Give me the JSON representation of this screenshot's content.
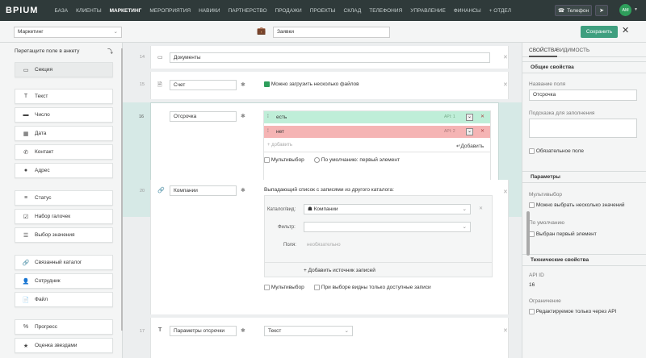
{
  "topbar": {
    "logo": "BPIUM",
    "nav": [
      "БАЗА",
      "КЛИЕНТЫ",
      "МАРКЕТИНГ",
      "МЕРОПРИЯТИЯ",
      "НАВИКИ",
      "ПАРТНЕРСТВО",
      "ПРОДАЖИ",
      "ПРОЕКТЫ",
      "СКЛАД",
      "ТЕЛЕФОНИЯ",
      "УПРАВЛЕНИЕ",
      "ФИНАНСЫ",
      "+ ОТДЕЛ"
    ],
    "active": "МАРКЕТИНГ",
    "phone": "Телефон",
    "avatar": "AM"
  },
  "toolbar": {
    "section": "Маркетинг",
    "form_name": "Заявки",
    "save": "Сохранить"
  },
  "left": {
    "header": "Перетащите поле в анкету",
    "items": [
      {
        "label": "Секция",
        "icon": "section-icon"
      },
      {
        "label": "Текст",
        "icon": "text-icon"
      },
      {
        "label": "Число",
        "icon": "number-icon"
      },
      {
        "label": "Дата",
        "icon": "calendar-icon"
      },
      {
        "label": "Контакт",
        "icon": "phone-icon"
      },
      {
        "label": "Адрес",
        "icon": "pin-icon"
      },
      {
        "label": "Статус",
        "icon": "status-icon"
      },
      {
        "label": "Набор галочек",
        "icon": "checkboxes-icon"
      },
      {
        "label": "Выбор значения",
        "icon": "list-icon"
      },
      {
        "label": "Связанный каталог",
        "icon": "link-icon"
      },
      {
        "label": "Сотрудник",
        "icon": "user-icon"
      },
      {
        "label": "Файл",
        "icon": "file-icon"
      },
      {
        "label": "Прогресс",
        "icon": "percent-icon"
      },
      {
        "label": "Оценка звездами",
        "icon": "star-icon"
      }
    ]
  },
  "center": {
    "rows": [
      {
        "num": "14",
        "name": "Документы"
      },
      {
        "num": "15",
        "name": "Счет",
        "option": "Можно загрузить несколько файлов"
      },
      {
        "num": "16",
        "name": "Отсрочка",
        "values": [
          {
            "label": "есть",
            "api": "API: 1"
          },
          {
            "label": "нет",
            "api": "API: 2"
          }
        ],
        "add_placeholder": "+ добавить",
        "add_btn": "Добавить",
        "multi": "Мультивыбор",
        "default": "По умолчанию: первый элемент"
      },
      {
        "num": "20",
        "name": "Компании",
        "desc": "Выпадающий список с записями из другого каталога:",
        "catalog_label": "Каталог/вид:",
        "catalog_value": "Компании",
        "filter_label": "Фильтр:",
        "fields_label": "Поля:",
        "fields_placeholder": "необязательно",
        "add_source": "+ Добавить источник записей",
        "multi": "Мультивыбор",
        "only_available": "При выборе видны только доступные записи"
      },
      {
        "num": "17",
        "name": "Параметры отсрочки",
        "type": "Текст"
      }
    ]
  },
  "right": {
    "tabs": [
      "СВОЙСТВА",
      "ВИДИМОСТЬ"
    ],
    "general_title": "Общие свойства",
    "name_label": "Название поля",
    "name_value": "Отсрочка",
    "hint_label": "Подсказка для заполнения",
    "required": "Обязательное поле",
    "params_title": "Параметры",
    "multi_label": "Мультивыбор",
    "multi_option": "Можно выбрать несколько значений",
    "default_label": "По умолчанию",
    "default_option": "Выбран первый элемент",
    "tech_title": "Технические свойства",
    "api_label": "API ID",
    "api_value": "16",
    "restrict_label": "Ограничение",
    "restrict_option": "Редактируемое только через API"
  },
  "colors": {
    "accent": "#3f9f7f",
    "topbar": "#2f3a3a",
    "value_green": "#bfeed8",
    "value_red": "#f5b4b4"
  }
}
